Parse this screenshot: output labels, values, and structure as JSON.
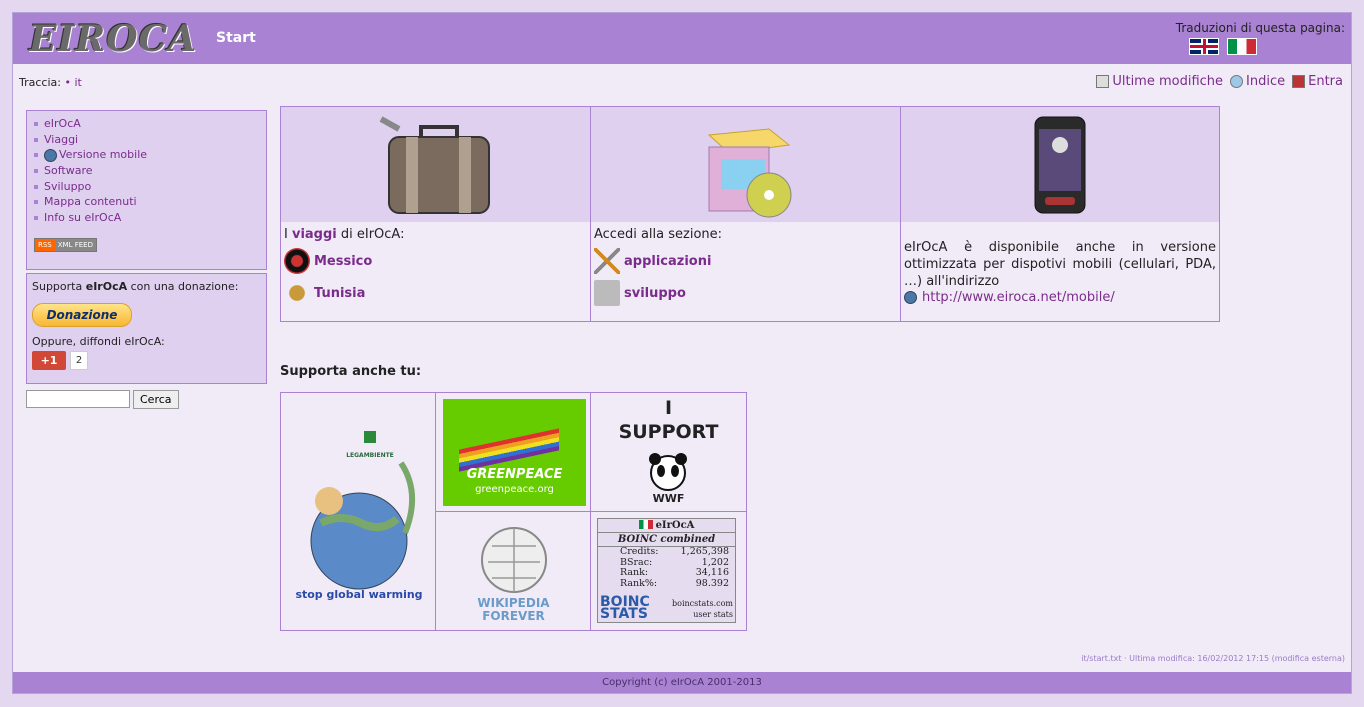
{
  "header": {
    "logo": "EIROCA",
    "page_name": "Start",
    "translations_label": "Traduzioni di questa pagina:"
  },
  "breadcrumb": {
    "label": "Traccia:",
    "item": "• it"
  },
  "tools": {
    "recent": "Ultime modifiche",
    "index": "Indice",
    "login": "Entra"
  },
  "sidebar": {
    "items": [
      {
        "label": "eIrOcA"
      },
      {
        "label": "Viaggi"
      },
      {
        "label": "Versione mobile"
      },
      {
        "label": "Software"
      },
      {
        "label": "Sviluppo"
      },
      {
        "label": "Mappa contenuti"
      },
      {
        "label": "Info su eIrOcA"
      }
    ],
    "rss_a": "RSS",
    "rss_b": "XML FEED"
  },
  "donate": {
    "text_pre": "Supporta ",
    "text_brand": "eIrOcA",
    "text_post": " con una donazione:",
    "button": "Donazione",
    "spread": "Oppure, diffondi eIrOcA:",
    "gplus": "+1",
    "gplus_count": "2"
  },
  "search": {
    "button": "Cerca",
    "placeholder": ""
  },
  "sections": {
    "travel": {
      "intro_pre": "I ",
      "intro_link": "viaggi",
      "intro_post": " di eIrOcA:",
      "links": [
        "Messico",
        "Tunisia"
      ]
    },
    "software": {
      "intro": "Accedi alla sezione:",
      "links": [
        "applicazioni",
        "sviluppo"
      ]
    },
    "mobile": {
      "text": "eIrOcA è disponibile anche in versione ottimizzata per dispotivi mobili (cellulari, PDA, …) all'indirizzo",
      "link": "http://www.eiroca.net/mobile/"
    }
  },
  "support": {
    "title": "Supporta anche tu:",
    "legambiente": "LEGAMBIENTE",
    "stop_global_warming": "stop global warming",
    "greenpeace": "GREENPEACE",
    "greenpeace_url": "greenpeace.org",
    "wwf_i": "I",
    "wwf_support": "SUPPORT",
    "wwf": "WWF",
    "wiki_line1": "WIKIPEDIA",
    "wiki_line2": "FOREVER",
    "boinc": {
      "user": "eIrOcA",
      "subtitle": "BOINC combined",
      "rows": [
        {
          "k": "Credits:",
          "v": "1,265,398"
        },
        {
          "k": "BSrac:",
          "v": "1,202"
        },
        {
          "k": "Rank:",
          "v": "34,116"
        },
        {
          "k": "Rank%:",
          "v": "98.392"
        }
      ],
      "logo_top": "BOINC",
      "logo_bottom": "STATS",
      "site": "boincstats.com",
      "site2": "user stats"
    }
  },
  "last_modified": "it/start.txt · Ultima modifica: 16/02/2012 17:15 (modifica esterna)",
  "footer": "Copyright (c) eIrOcA 2001-2013",
  "colors": {
    "header": "#a982d3",
    "link": "#7a2c8a",
    "panel": "#e0d0f0"
  }
}
